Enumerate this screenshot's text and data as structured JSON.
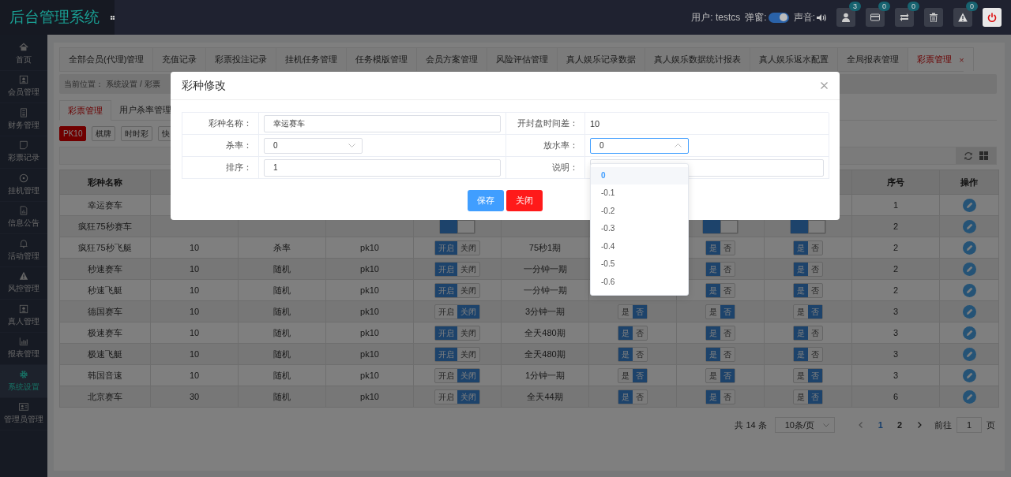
{
  "topbar": {
    "logo": "后台管理系统",
    "user": "用户: testcs",
    "popup_label": "弹窗:",
    "popup_on": true,
    "sound_label": "声音:",
    "buttons": [
      {
        "kind": "user",
        "badge": "3"
      },
      {
        "kind": "card",
        "badge": "0"
      },
      {
        "kind": "transfer",
        "badge": "0"
      },
      {
        "kind": "trash"
      },
      {
        "kind": "alert",
        "badge": "0"
      },
      {
        "kind": "power"
      }
    ]
  },
  "sidebar": {
    "items": [
      {
        "label": "首页",
        "selected": false
      },
      {
        "label": "会员管理",
        "selected": false
      },
      {
        "label": "财务管理",
        "selected": false
      },
      {
        "label": "彩票记录",
        "selected": false
      },
      {
        "label": "挂机管理",
        "selected": false
      },
      {
        "label": "信息公告",
        "selected": false
      },
      {
        "label": "活动管理",
        "selected": false
      },
      {
        "label": "风控管理",
        "selected": false
      },
      {
        "label": "真人管理",
        "selected": false
      },
      {
        "label": "报表管理",
        "selected": false
      },
      {
        "label": "系统设置",
        "selected": true
      },
      {
        "label": "管理员管理",
        "selected": false
      }
    ]
  },
  "tabs": [
    {
      "label": "全部会员(代理)管理",
      "selected": false
    },
    {
      "label": "充值记录",
      "selected": false
    },
    {
      "label": "彩票投注记录",
      "selected": false
    },
    {
      "label": "挂机任务管理",
      "selected": false
    },
    {
      "label": "任务模版管理",
      "selected": false
    },
    {
      "label": "会员方案管理",
      "selected": false
    },
    {
      "label": "风险评估管理",
      "selected": false
    },
    {
      "label": "真人娱乐记录数据",
      "selected": false
    },
    {
      "label": "真人娱乐数据统计报表",
      "selected": false
    },
    {
      "label": "真人娱乐返水配置",
      "selected": false
    },
    {
      "label": "全局报表管理",
      "selected": false
    },
    {
      "label": "彩票管理",
      "selected": true,
      "close": "×"
    }
  ],
  "breadcrumb": {
    "label": "当前位置：",
    "items": [
      "系统设置",
      "彩票"
    ],
    "separator": "/"
  },
  "sub_tabs": [
    {
      "label": "彩票管理",
      "selected": true
    },
    {
      "label": "用户杀率管理",
      "selected": false
    }
  ],
  "filters": [
    {
      "label": "PK10",
      "selected": true
    },
    {
      "label": "棋牌",
      "selected": false
    },
    {
      "label": "时时彩",
      "selected": false
    },
    {
      "label": "快",
      "selected": false
    }
  ],
  "table": {
    "columns": {
      "column_1": "彩种名称",
      "column_10": "序号",
      "column_11": "操作"
    },
    "rows": [
      {
        "column_1": "幸运赛车",
        "column_10": "1",
        "column_11": {
          "kind": "edit"
        }
      },
      {
        "column_1": "疯狂75秒赛车",
        "column_5": {
          "kind": "switch",
          "options": [
            {
              "selected": true
            },
            {
              "selected": false
            }
          ]
        },
        "column_8": {
          "kind": "switch",
          "options": [
            {
              "selected": true
            },
            {
              "selected": false
            }
          ]
        },
        "column_9": {
          "kind": "switch",
          "options": [
            {
              "selected": true
            },
            {
              "selected": false
            }
          ]
        },
        "column_10": "2",
        "column_11": {
          "kind": "edit"
        }
      },
      {
        "column_1": "疯狂75秒飞艇",
        "column_2": "10",
        "column_3": "杀率",
        "column_4": "pk10",
        "column_5": {
          "kind": "switch",
          "options": [
            {
              "label": "开启",
              "selected": true
            },
            {
              "label": "关闭",
              "selected": false
            }
          ]
        },
        "column_6": "75秒1期",
        "column_8": {
          "kind": "switch",
          "options": [
            {
              "label": "是",
              "selected": true
            },
            {
              "label": "否",
              "selected": false
            }
          ]
        },
        "column_9": {
          "kind": "switch",
          "options": [
            {
              "label": "是",
              "selected": true
            },
            {
              "label": "否",
              "selected": false
            }
          ]
        },
        "column_10": "2",
        "column_11": {
          "kind": "edit"
        }
      },
      {
        "column_1": "秒速赛车",
        "column_2": "10",
        "column_3": "随机",
        "column_4": "pk10",
        "column_5": {
          "kind": "switch",
          "options": [
            {
              "label": "开启",
              "selected": true
            },
            {
              "label": "关闭",
              "selected": false
            }
          ]
        },
        "column_6": "一分钟一期",
        "column_8": {
          "kind": "switch",
          "options": [
            {
              "label": "是",
              "selected": true
            },
            {
              "label": "否",
              "selected": false
            }
          ]
        },
        "column_9": {
          "kind": "switch",
          "options": [
            {
              "label": "是",
              "selected": true
            },
            {
              "label": "否",
              "selected": false
            }
          ]
        },
        "column_10": "2",
        "column_11": {
          "kind": "edit"
        }
      },
      {
        "column_1": "秒速飞艇",
        "column_2": "10",
        "column_3": "随机",
        "column_4": "pk10",
        "column_5": {
          "kind": "switch",
          "options": [
            {
              "label": "开启",
              "selected": true
            },
            {
              "label": "关闭",
              "selected": false
            }
          ]
        },
        "column_6": "一分钟一期",
        "column_8": {
          "kind": "switch",
          "options": [
            {
              "label": "是",
              "selected": true
            },
            {
              "label": "否",
              "selected": false
            }
          ]
        },
        "column_9": {
          "kind": "switch",
          "options": [
            {
              "label": "是",
              "selected": true
            },
            {
              "label": "否",
              "selected": false
            }
          ]
        },
        "column_10": "2",
        "column_11": {
          "kind": "edit"
        }
      },
      {
        "column_1": "德国赛车",
        "column_2": "10",
        "column_3": "随机",
        "column_4": "pk10",
        "column_5": {
          "kind": "switch",
          "options": [
            {
              "label": "开启",
              "selected": false
            },
            {
              "label": "关闭",
              "selected": true
            }
          ]
        },
        "column_6": "3分钟一期",
        "column_7": {
          "kind": "switch",
          "options": [
            {
              "label": "是",
              "selected": false
            },
            {
              "label": "否",
              "selected": true
            }
          ]
        },
        "column_8": {
          "kind": "switch",
          "options": [
            {
              "label": "是",
              "selected": false
            },
            {
              "label": "否",
              "selected": true
            }
          ]
        },
        "column_9": {
          "kind": "switch",
          "options": [
            {
              "label": "是",
              "selected": false
            },
            {
              "label": "否",
              "selected": true
            }
          ]
        },
        "column_10": "3",
        "column_11": {
          "kind": "edit"
        }
      },
      {
        "column_1": "极速赛车",
        "column_2": "10",
        "column_3": "随机",
        "column_4": "pk10",
        "column_5": {
          "kind": "switch",
          "options": [
            {
              "label": "开启",
              "selected": true
            },
            {
              "label": "关闭",
              "selected": false
            }
          ]
        },
        "column_6": "全天480期",
        "column_7": {
          "kind": "switch",
          "options": [
            {
              "label": "是",
              "selected": true
            },
            {
              "label": "否",
              "selected": false
            }
          ]
        },
        "column_8": {
          "kind": "switch",
          "options": [
            {
              "label": "是",
              "selected": true
            },
            {
              "label": "否",
              "selected": false
            }
          ]
        },
        "column_9": {
          "kind": "switch",
          "options": [
            {
              "label": "是",
              "selected": true
            },
            {
              "label": "否",
              "selected": false
            }
          ]
        },
        "column_10": "3",
        "column_11": {
          "kind": "edit"
        }
      },
      {
        "column_1": "极速飞艇",
        "column_2": "10",
        "column_3": "随机",
        "column_4": "pk10",
        "column_5": {
          "kind": "switch",
          "options": [
            {
              "label": "开启",
              "selected": true
            },
            {
              "label": "关闭",
              "selected": false
            }
          ]
        },
        "column_6": "全天480期",
        "column_7": {
          "kind": "switch",
          "options": [
            {
              "label": "是",
              "selected": true
            },
            {
              "label": "否",
              "selected": false
            }
          ]
        },
        "column_8": {
          "kind": "switch",
          "options": [
            {
              "label": "是",
              "selected": true
            },
            {
              "label": "否",
              "selected": false
            }
          ]
        },
        "column_9": {
          "kind": "switch",
          "options": [
            {
              "label": "是",
              "selected": true
            },
            {
              "label": "否",
              "selected": false
            }
          ]
        },
        "column_10": "3",
        "column_11": {
          "kind": "edit"
        }
      },
      {
        "column_1": "韩国音速",
        "column_2": "10",
        "column_3": "随机",
        "column_4": "pk10",
        "column_5": {
          "kind": "switch",
          "options": [
            {
              "label": "开启",
              "selected": false
            },
            {
              "label": "关闭",
              "selected": true
            }
          ]
        },
        "column_6": "1分钟一期",
        "column_7": {
          "kind": "switch",
          "options": [
            {
              "label": "是",
              "selected": false
            },
            {
              "label": "否",
              "selected": true
            }
          ]
        },
        "column_8": {
          "kind": "switch",
          "options": [
            {
              "label": "是",
              "selected": false
            },
            {
              "label": "否",
              "selected": true
            }
          ]
        },
        "column_9": {
          "kind": "switch",
          "options": [
            {
              "label": "是",
              "selected": false
            },
            {
              "label": "否",
              "selected": true
            }
          ]
        },
        "column_10": "3",
        "column_11": {
          "kind": "edit"
        }
      },
      {
        "column_1": "北京赛车",
        "column_2": "30",
        "column_3": "随机",
        "column_4": "pk10",
        "column_5": {
          "kind": "switch",
          "options": [
            {
              "label": "开启",
              "selected": false
            },
            {
              "label": "关闭",
              "selected": true
            }
          ]
        },
        "column_6": "全天44期",
        "column_7": {
          "kind": "switch",
          "options": [
            {
              "label": "是",
              "selected": true
            },
            {
              "label": "否",
              "selected": false
            }
          ]
        },
        "column_8": {
          "kind": "switch",
          "options": [
            {
              "label": "是",
              "selected": true
            },
            {
              "label": "否",
              "selected": false
            }
          ]
        },
        "column_9": {
          "kind": "switch",
          "options": [
            {
              "label": "是",
              "selected": false
            },
            {
              "label": "否",
              "selected": true
            }
          ]
        },
        "column_10": "6",
        "column_11": {
          "kind": "edit"
        }
      }
    ]
  },
  "pagination": {
    "total": "共 14 条",
    "page_size": "10条/页",
    "pages": [
      {
        "label": "1",
        "selected": true
      },
      {
        "label": "2",
        "selected": false
      }
    ],
    "goto_label": "前往",
    "goto_value": "1",
    "page_suffix": "页"
  },
  "modal": {
    "title": "彩种修改",
    "fields": [
      {
        "label": "彩种名称：",
        "kind": "input",
        "value": "幸运赛车"
      },
      {
        "label": "开封盘时间差：",
        "kind": "text",
        "value": "10"
      },
      {
        "label": "杀率：",
        "kind": "select",
        "value": "0",
        "expanded": false
      },
      {
        "label": "放水率：",
        "kind": "select",
        "value": "0",
        "expanded": true,
        "options": [
          {
            "label": "0",
            "selected": true
          },
          {
            "label": "-0.1",
            "selected": false
          },
          {
            "label": "-0.2",
            "selected": false
          },
          {
            "label": "-0.3",
            "selected": false
          },
          {
            "label": "-0.4",
            "selected": false
          },
          {
            "label": "-0.5",
            "selected": false
          },
          {
            "label": "-0.6",
            "selected": false
          }
        ]
      },
      {
        "label": "排序：",
        "kind": "input",
        "value": "1"
      },
      {
        "label": "说明：",
        "kind": "input"
      }
    ],
    "buttons": [
      {
        "label": "保存",
        "kind": "primary"
      },
      {
        "label": "关闭",
        "kind": "danger"
      }
    ]
  }
}
